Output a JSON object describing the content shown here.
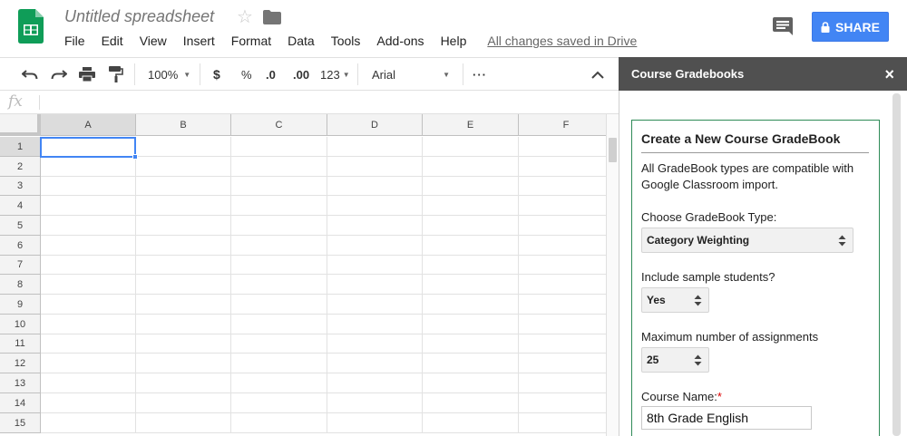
{
  "header": {
    "title": "Untitled spreadsheet",
    "menu": [
      "File",
      "Edit",
      "View",
      "Insert",
      "Format",
      "Data",
      "Tools",
      "Add-ons",
      "Help"
    ],
    "saved_status": "All changes saved in Drive",
    "share_label": "SHARE"
  },
  "toolbar": {
    "zoom": "100%",
    "currency": "$",
    "percent": "%",
    "decrease_decimal": ".0",
    "increase_decimal": ".00",
    "number_format": "123",
    "font": "Arial",
    "more": "···"
  },
  "formula_bar": {
    "label": "fx"
  },
  "sheet": {
    "columns": [
      "A",
      "B",
      "C",
      "D",
      "E",
      "F"
    ],
    "rows": [
      "1",
      "2",
      "3",
      "4",
      "5",
      "6",
      "7",
      "8",
      "9",
      "10",
      "11",
      "12",
      "13",
      "14",
      "15"
    ],
    "active_cell": "A1"
  },
  "panel": {
    "title": "Course Gradebooks",
    "close": "×",
    "card_title": "Create a New Course GradeBook",
    "intro": "All GradeBook types are compatible with Google Classroom import.",
    "type_label": "Choose GradeBook Type:",
    "type_value": "Category Weighting",
    "sample_label": "Include sample students?",
    "sample_value": "Yes",
    "max_label": "Maximum number of assignments",
    "max_value": "25",
    "course_label": "Course Name:",
    "course_required": "*",
    "course_value": "8th Grade English"
  },
  "colors": {
    "accent": "#4285f4",
    "panel_header": "#505050",
    "card_border": "#2e8b57",
    "sheets_green": "#0f9d58"
  },
  "icons": [
    "sheets-logo-icon",
    "star-icon",
    "folder-icon",
    "comment-icon",
    "lock-icon",
    "undo-icon",
    "redo-icon",
    "print-icon",
    "paint-format-icon",
    "collapse-icon",
    "close-icon",
    "up-down-icon"
  ]
}
